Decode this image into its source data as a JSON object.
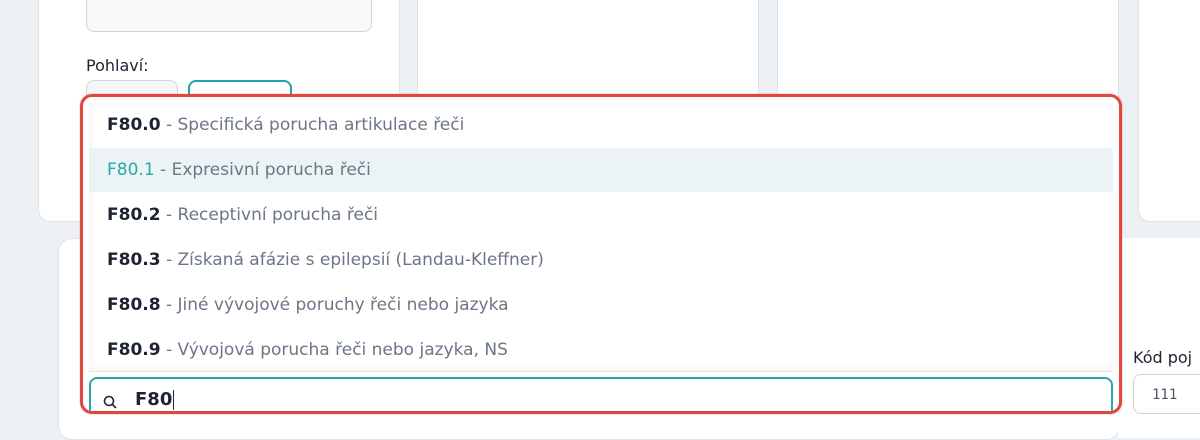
{
  "form": {
    "gender_label": "Pohlaví:",
    "insurance_code_label": "Kód poj",
    "insurance_code_value": "111"
  },
  "diagnosis_dropdown": {
    "search_value": "F80",
    "options": [
      {
        "code": "F80.0",
        "separator": " - ",
        "description": "Specifická porucha artikulace řeči",
        "active": false
      },
      {
        "code": "F80.1",
        "separator": " - ",
        "description": "Expresivní porucha řeči",
        "active": true
      },
      {
        "code": "F80.2",
        "separator": " - ",
        "description": "Receptivní porucha řeči",
        "active": false
      },
      {
        "code": "F80.3",
        "separator": " - ",
        "description": "Získaná afázie s epilepsií (Landau-Kleffner)",
        "active": false
      },
      {
        "code": "F80.8",
        "separator": " - ",
        "description": "Jiné vývojové poruchy řeči nebo jazyka",
        "active": false
      },
      {
        "code": "F80.9",
        "separator": " - ",
        "description": "Vývojová porucha řeči nebo jazyka, NS",
        "active": false
      }
    ]
  },
  "colors": {
    "accent": "#26a8ab",
    "highlight_border": "#e0473f",
    "active_row": "#ebf3f5"
  },
  "icons": {
    "search": "search-icon"
  }
}
